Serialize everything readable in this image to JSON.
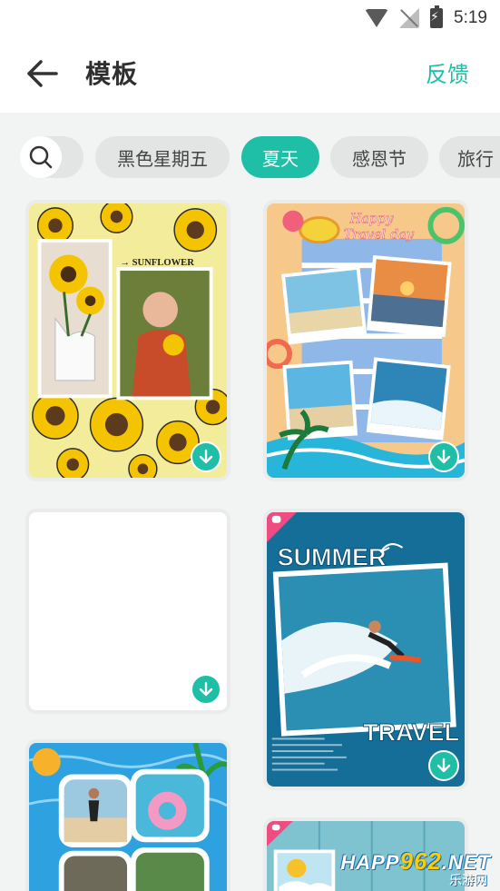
{
  "status_bar": {
    "time": "5:19",
    "icons": [
      "wifi-icon",
      "no-signal-icon",
      "battery-charging-icon"
    ]
  },
  "header": {
    "title": "模板",
    "feedback_label": "反馈",
    "back_icon": "arrow-left-icon"
  },
  "categories": {
    "search_icon": "search-icon",
    "items": [
      {
        "label": "黑色星期五",
        "active": false
      },
      {
        "label": "夏天",
        "active": true
      },
      {
        "label": "感恩节",
        "active": false
      },
      {
        "label": "旅行",
        "active": false
      }
    ]
  },
  "templates": [
    {
      "name": "sunflower",
      "caption": "SUNFLOWER",
      "download_icon": "download-icon"
    },
    {
      "name": "happy-travel-day",
      "caption": "Happy Travel day",
      "download_icon": "download-icon"
    },
    {
      "name": "blank",
      "caption": "",
      "download_icon": "download-icon"
    },
    {
      "name": "summer-travel",
      "caption_top": "SUMMER",
      "caption_bottom": "TRAVEL",
      "download_icon": "download-icon"
    },
    {
      "name": "pool-party",
      "caption": ""
    },
    {
      "name": "happy-summer",
      "caption": "HAPP"
    }
  ],
  "watermark": {
    "brand_prefix": "HAPP",
    "brand_num": "962",
    "brand_suffix": ".NET",
    "brand_sub": "乐游网"
  },
  "colors": {
    "accent": "#1fbfa7",
    "chip_bg": "#e3e4e4",
    "page_bg": "#f2f3f3"
  }
}
